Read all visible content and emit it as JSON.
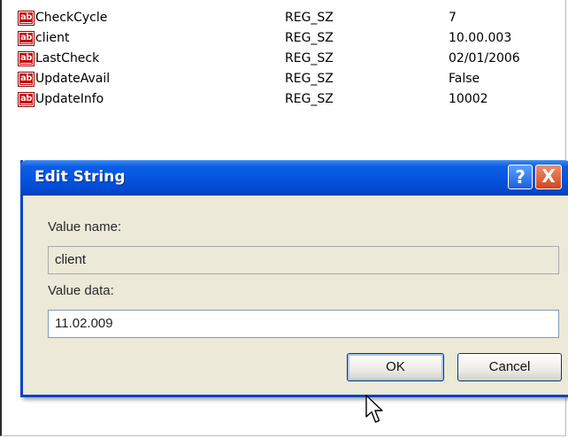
{
  "registry": {
    "rows": [
      {
        "name": "CheckCycle",
        "type": "REG_SZ",
        "data": "7"
      },
      {
        "name": "client",
        "type": "REG_SZ",
        "data": "10.00.003"
      },
      {
        "name": "LastCheck",
        "type": "REG_SZ",
        "data": "02/01/2006"
      },
      {
        "name": "UpdateAvail",
        "type": "REG_SZ",
        "data": "False"
      },
      {
        "name": "UpdateInfo",
        "type": "REG_SZ",
        "data": "10002"
      }
    ],
    "icon_text": "ab"
  },
  "dialog": {
    "title": "Edit String",
    "help_glyph": "?",
    "close_glyph": "X",
    "value_name_label": "Value name:",
    "value_name": "client",
    "value_data_label": "Value data:",
    "value_data": "11.02.009",
    "ok_label": "OK",
    "cancel_label": "Cancel"
  },
  "colors": {
    "titlebar": "#0555e0",
    "dialog_bg": "#ece9d8",
    "close_button": "#d1461f",
    "string_icon": "#c40000"
  },
  "icons": [
    "string-value-icon",
    "help-icon",
    "close-icon",
    "mouse-pointer-icon"
  ]
}
